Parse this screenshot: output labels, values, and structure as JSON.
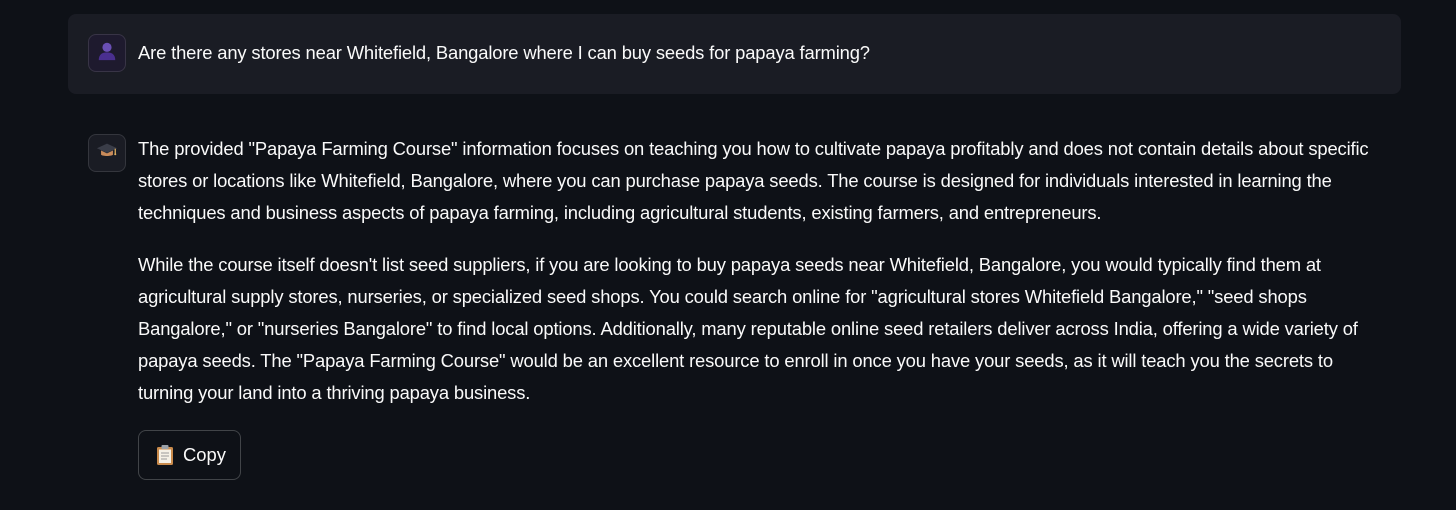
{
  "user_message": {
    "avatar_icon": "user-icon",
    "text": "Are there any stores near Whitefield, Bangalore where I can buy seeds for papaya farming?"
  },
  "assistant_message": {
    "avatar_icon": "graduation-cap-icon",
    "paragraphs": [
      "The provided \"Papaya Farming Course\" information focuses on teaching you how to cultivate papaya profitably and does not contain details about specific stores or locations like Whitefield, Bangalore, where you can purchase papaya seeds. The course is designed for individuals interested in learning the techniques and business aspects of papaya farming, including agricultural students, existing farmers, and entrepreneurs.",
      "While the course itself doesn't list seed suppliers, if you are looking to buy papaya seeds near Whitefield, Bangalore, you would typically find them at agricultural supply stores, nurseries, or specialized seed shops. You could search online for \"agricultural stores Whitefield Bangalore,\" \"seed shops Bangalore,\" or \"nurseries Bangalore\" to find local options. Additionally, many reputable online seed retailers deliver across India, offering a wide variety of papaya seeds. The \"Papaya Farming Course\" would be an excellent resource to enroll in once you have your seeds, as it will teach you the secrets to turning your land into a thriving papaya business."
    ],
    "copy_button": {
      "icon": "clipboard-icon",
      "label": "Copy"
    }
  },
  "colors": {
    "background": "#0e1117",
    "user_bubble": "#1a1c24",
    "text": "#fafafa",
    "user_avatar_accent": "#7b5cc7"
  }
}
